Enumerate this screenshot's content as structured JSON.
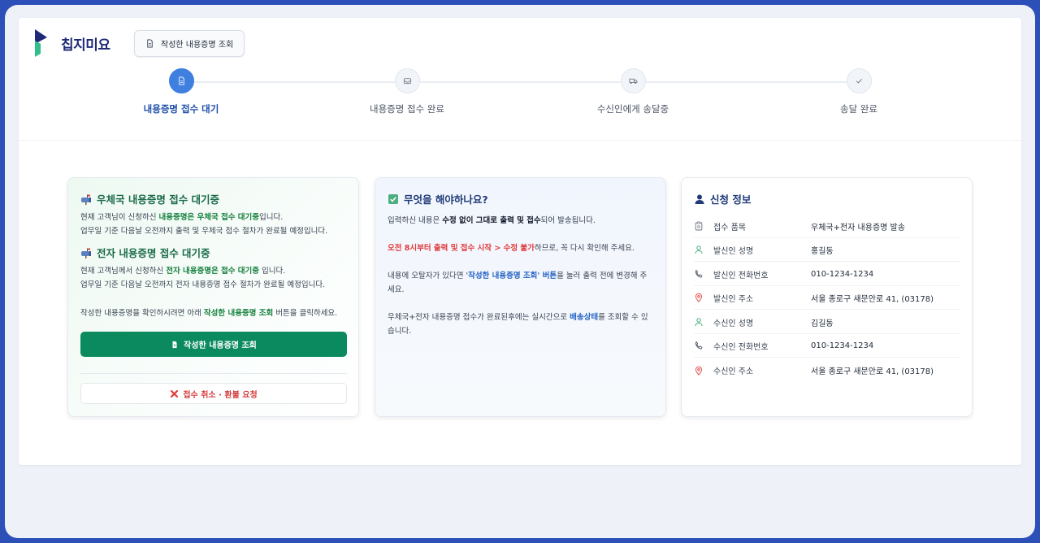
{
  "header": {
    "logo_text": "칩지미요",
    "view_button_label": "작성한 내용증명 조회"
  },
  "steps": [
    {
      "label": "내용증명 접수 대기",
      "icon": "document-icon",
      "active": true
    },
    {
      "label": "내용증명 접수 완료",
      "icon": "inbox-icon",
      "active": false
    },
    {
      "label": "수신인에게 송달중",
      "icon": "truck-icon",
      "active": false
    },
    {
      "label": "송달 완료",
      "icon": "check-icon",
      "active": false
    }
  ],
  "status_panel": {
    "postal": {
      "title": "우체국 내용증명 접수 대기중",
      "line1_pre": "현재 고객님이 신청하신 ",
      "line1_hl": "내용증명은 우체국 접수 대기중",
      "line1_post": "입니다.",
      "line2": "업무일 기준 다음날 오전까지 출력 및 우체국 접수 절차가 완료될 예정입니다."
    },
    "electronic": {
      "title": "전자 내용증명 접수 대기중",
      "line1_pre": "현재 고객님께서 신청하신 ",
      "line1_hl": "전자 내용증명은 접수 대기중",
      "line1_post": " 입니다.",
      "line2": "업무일 기준 다음날 오전까지 전자 내용증명 접수 절차가 완료될 예정입니다."
    },
    "guide_pre": "작성한 내용증명을 확인하시려면 아래 ",
    "guide_hl": "작성한 내용증명 조회",
    "guide_post": " 버튼을 클릭하세요.",
    "view_button_label": "작성한 내용증명 조회",
    "cancel_button_label": "접수 취소 · 환불 요청"
  },
  "todo_panel": {
    "title": "무엇을 해야하나요?",
    "p1_pre": "입력하신 내용은 ",
    "p1_b": "수정 없이 그대로 출력 및 접수",
    "p1_post": "되어 발송됩니다.",
    "p2_hl": "오전 8시부터 출력 및 접수 시작 > 수정 불가",
    "p2_post": "하므로, 꼭 다시 확인해 주세요.",
    "p3_pre": "내용에 오탈자가 있다면 '",
    "p3_hl": "작성한 내용증명 조회",
    "p3_mid": "' 버튼",
    "p3_post": "을 눌러 출력 전에 변경해 주세요.",
    "p4_pre": "우체국+전자 내용증명 접수가 완료된후에는 실시간으로 ",
    "p4_hl": "배송상태",
    "p4_post": "를 조회할 수 있습니다."
  },
  "apply_panel": {
    "title": "신청 정보",
    "rows": [
      {
        "icon": "clipboard-icon",
        "key": "접수 품목",
        "value": "우체국+전자 내용증명 발송"
      },
      {
        "icon": "user-icon",
        "key": "발신인 성명",
        "value": "홍길동"
      },
      {
        "icon": "phone-icon",
        "key": "발신인 전화번호",
        "value": "010-1234-1234"
      },
      {
        "icon": "map-pin-icon",
        "key": "발신인 주소",
        "value": "서울 종로구 새문안로 41, (03178)"
      },
      {
        "icon": "user-icon",
        "key": "수신인 성명",
        "value": "김길동"
      },
      {
        "icon": "phone-icon",
        "key": "수신인 전화번호",
        "value": "010-1234-1234"
      },
      {
        "icon": "map-pin-icon",
        "key": "수신인 주소",
        "value": "서울 종로구 새문안로 41, (03178)"
      }
    ]
  },
  "colors": {
    "brand_navy": "#1e2a78",
    "active_step": "#3f7fe0",
    "primary_green": "#0a8a5e",
    "danger_red": "#d23d3d"
  }
}
